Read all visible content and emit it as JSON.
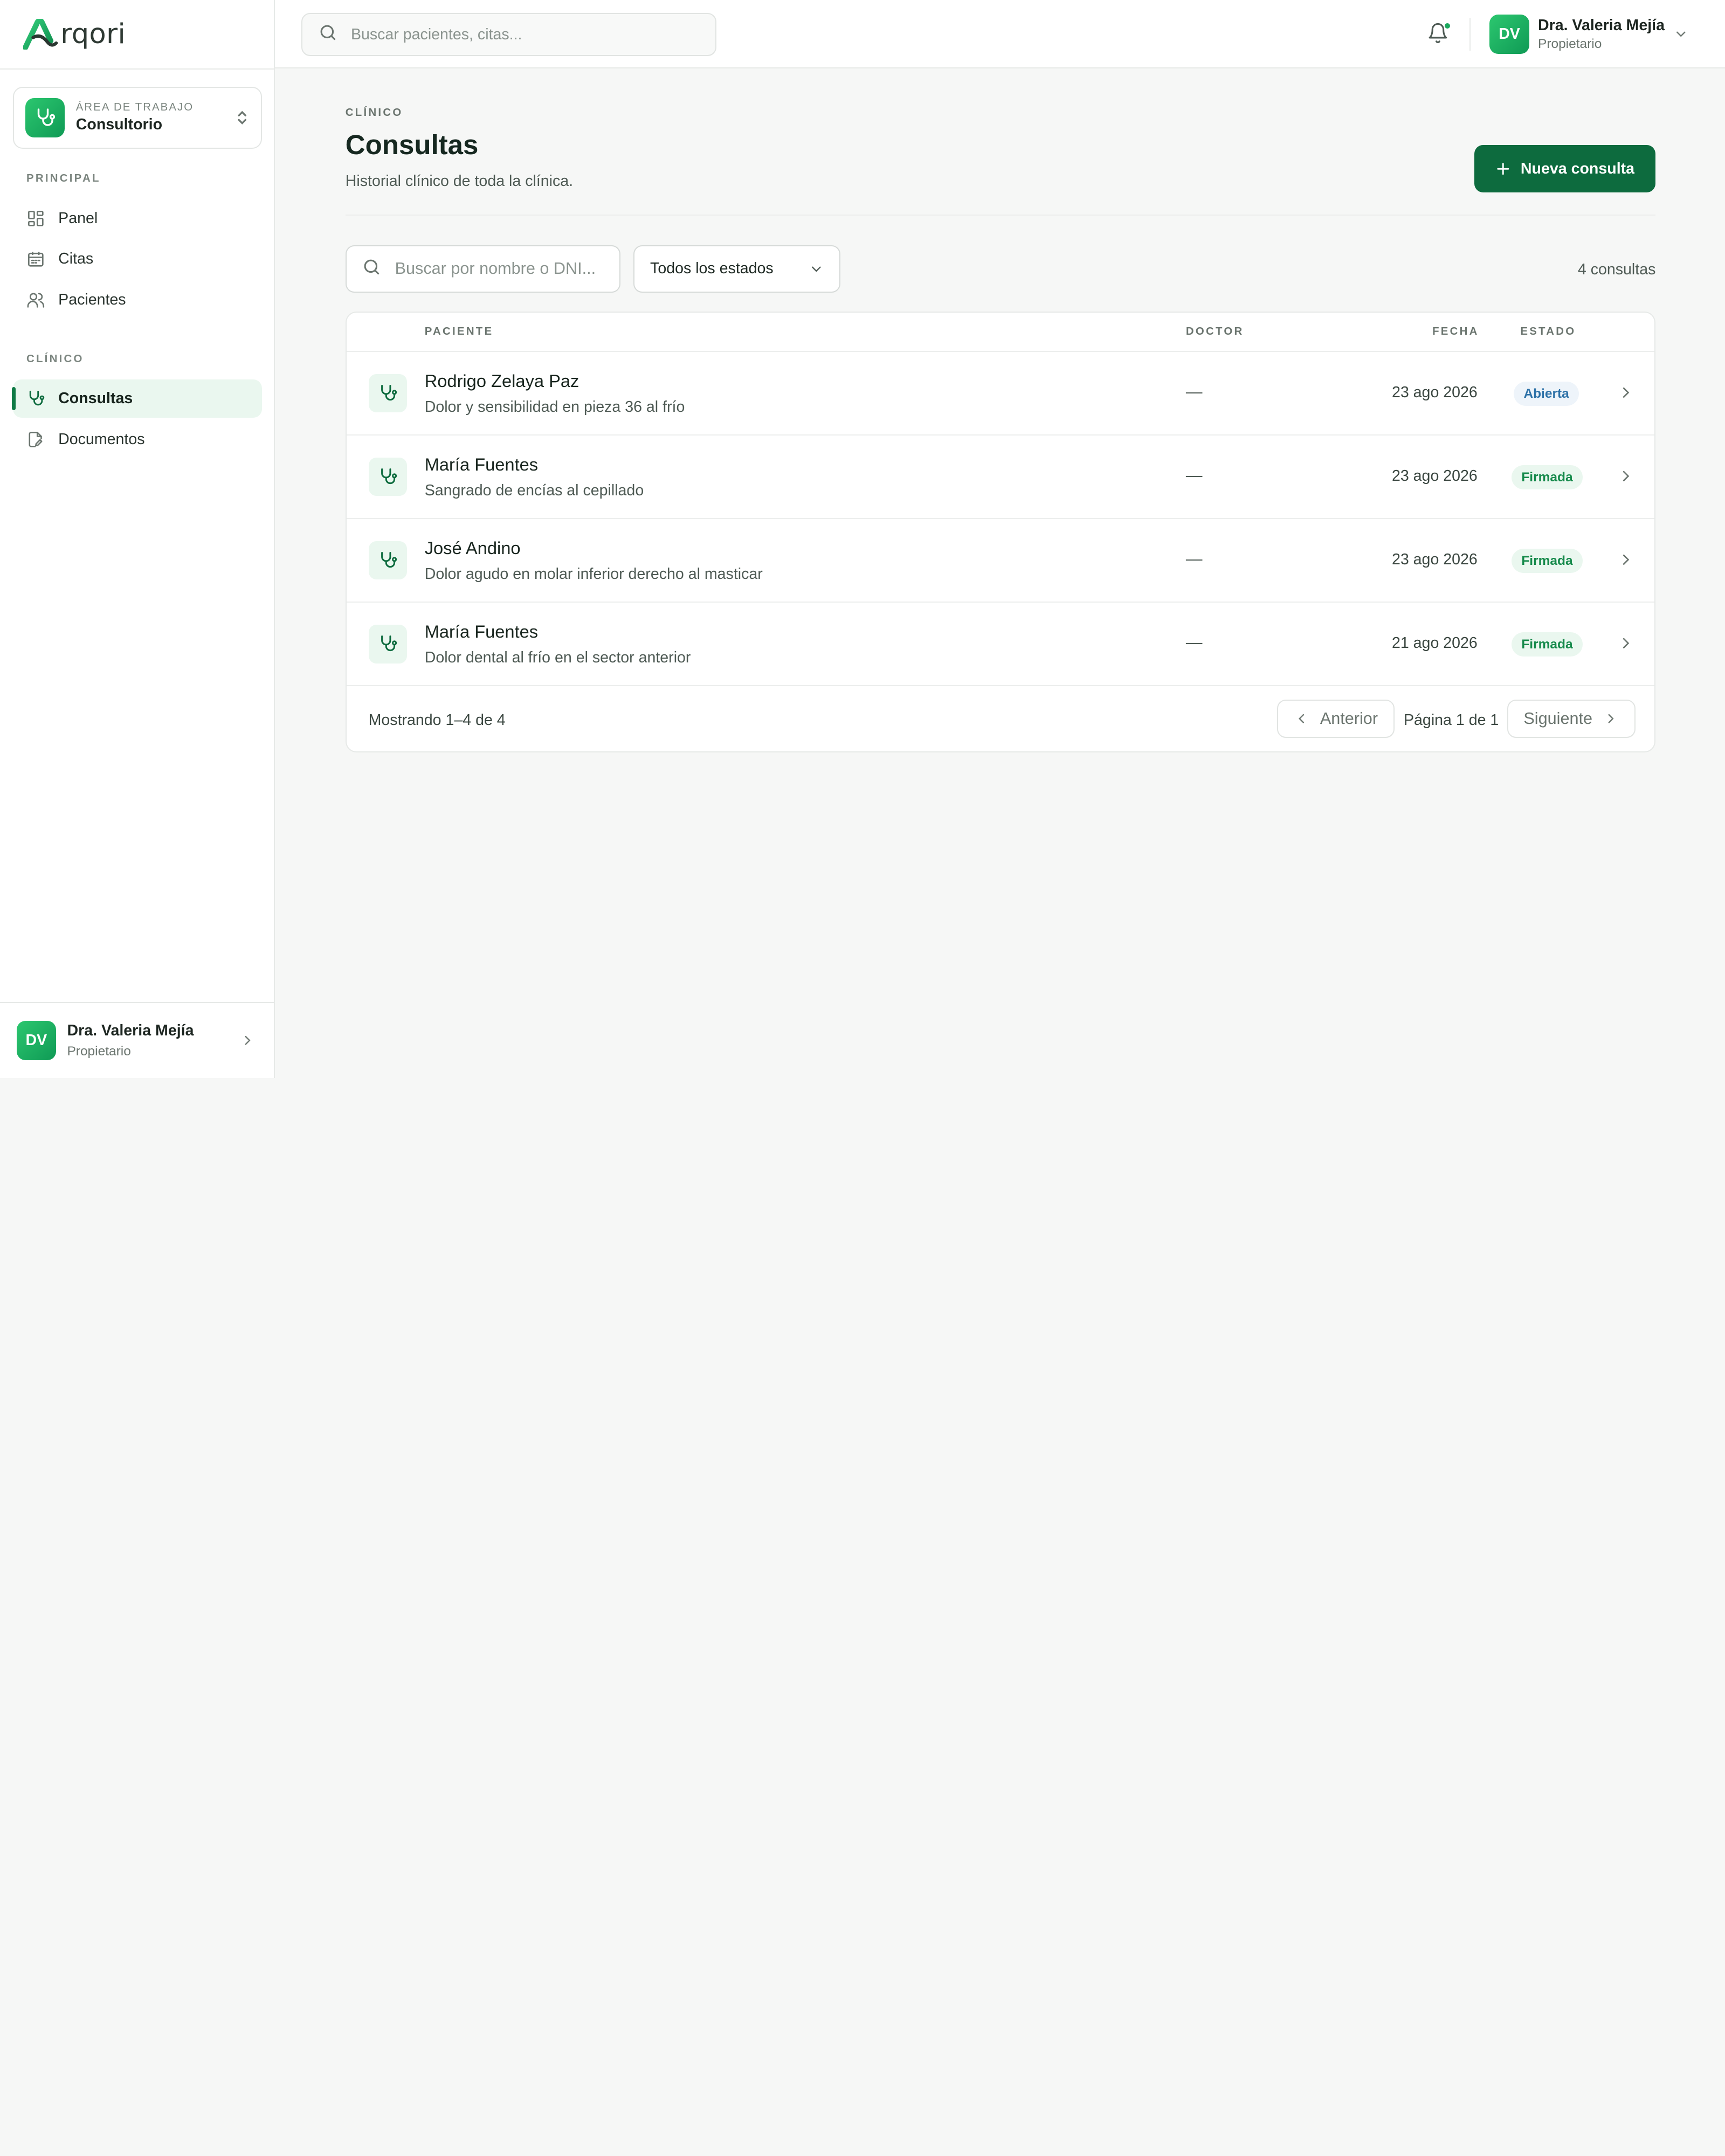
{
  "brand": {
    "name": "rqori"
  },
  "sidebar": {
    "workspace": {
      "label": "ÁREA DE TRABAJO",
      "name": "Consultorio"
    },
    "sections": [
      {
        "label": "PRINCIPAL",
        "items": [
          {
            "label": "Panel",
            "icon": "grid-icon"
          },
          {
            "label": "Citas",
            "icon": "calendar-icon"
          },
          {
            "label": "Pacientes",
            "icon": "users-icon"
          }
        ]
      },
      {
        "label": "CLÍNICO",
        "items": [
          {
            "label": "Consultas",
            "icon": "stethoscope-icon",
            "active": true
          },
          {
            "label": "Documentos",
            "icon": "document-edit-icon"
          }
        ]
      }
    ],
    "user": {
      "initials": "DV",
      "name": "Dra. Valeria Mejía",
      "role": "Propietario"
    }
  },
  "topbar": {
    "search_placeholder": "Buscar pacientes, citas...",
    "user": {
      "initials": "DV",
      "name": "Dra. Valeria Mejía",
      "role": "Propietario"
    }
  },
  "page": {
    "eyebrow": "CLÍNICO",
    "title": "Consultas",
    "subtitle": "Historial clínico de toda la clínica.",
    "new_button": "Nueva consulta"
  },
  "filters": {
    "search_placeholder": "Buscar por nombre o DNI...",
    "status_select": "Todos los estados",
    "count_text": "4 consultas"
  },
  "table": {
    "columns": {
      "patient": "PACIENTE",
      "doctor": "DOCTOR",
      "date": "FECHA",
      "status": "ESTADO"
    },
    "rows": [
      {
        "name": "Rodrigo Zelaya Paz",
        "desc": "Dolor y sensibilidad en pieza 36 al frío",
        "doctor": "—",
        "date": "23 ago 2026",
        "status": "Abierta"
      },
      {
        "name": "María Fuentes",
        "desc": "Sangrado de encías al cepillado",
        "doctor": "—",
        "date": "23 ago 2026",
        "status": "Firmada"
      },
      {
        "name": "José Andino",
        "desc": "Dolor agudo en molar inferior derecho al masticar",
        "doctor": "—",
        "date": "23 ago 2026",
        "status": "Firmada"
      },
      {
        "name": "María Fuentes",
        "desc": "Dolor dental al frío en el sector anterior",
        "doctor": "—",
        "date": "21 ago 2026",
        "status": "Firmada"
      }
    ],
    "footer": {
      "showing": "Mostrando 1–4 de 4",
      "prev": "Anterior",
      "page_info": "Página 1 de 1",
      "next": "Siguiente"
    }
  },
  "colors": {
    "primary": "#0d6b3e",
    "accent": "#1aa85d",
    "open_badge": "#2e72a8",
    "signed_badge": "#168a4b"
  }
}
